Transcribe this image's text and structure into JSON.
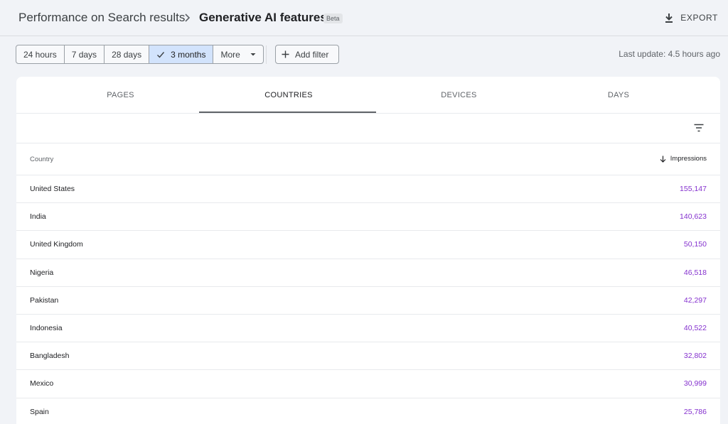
{
  "header": {
    "parent": "Performance on Search results",
    "current": "Generative AI features",
    "badge": "Beta",
    "export_label": "EXPORT"
  },
  "toolbar": {
    "ranges": [
      "24 hours",
      "7 days",
      "28 days",
      "3 months",
      "More"
    ],
    "selected_range": "3 months",
    "add_filter": "Add filter",
    "last_update": "Last update: 4.5 hours ago"
  },
  "tabs": [
    "PAGES",
    "COUNTRIES",
    "DEVICES",
    "DAYS"
  ],
  "active_tab": "COUNTRIES",
  "table": {
    "columns": {
      "country": "Country",
      "impressions": "Impressions"
    },
    "sort": "descending",
    "rows": [
      {
        "country": "United States",
        "impressions": "155,147"
      },
      {
        "country": "India",
        "impressions": "140,623"
      },
      {
        "country": "United Kingdom",
        "impressions": "50,150"
      },
      {
        "country": "Nigeria",
        "impressions": "46,518"
      },
      {
        "country": "Pakistan",
        "impressions": "42,297"
      },
      {
        "country": "Indonesia",
        "impressions": "40,522"
      },
      {
        "country": "Bangladesh",
        "impressions": "32,802"
      },
      {
        "country": "Mexico",
        "impressions": "30,999"
      },
      {
        "country": "Spain",
        "impressions": "25,786"
      }
    ]
  },
  "icons": {
    "breadcrumb_separator": "chevron-right-icon",
    "export": "download-icon",
    "selected_check": "check-icon",
    "more_caret": "caret-down-icon",
    "add_filter": "plus-icon",
    "table_filter": "filter-list-icon",
    "sort": "arrow-down-icon"
  },
  "colors": {
    "selected_range_bg": "#d2e3fc",
    "impressions_value": "#8430ce"
  }
}
